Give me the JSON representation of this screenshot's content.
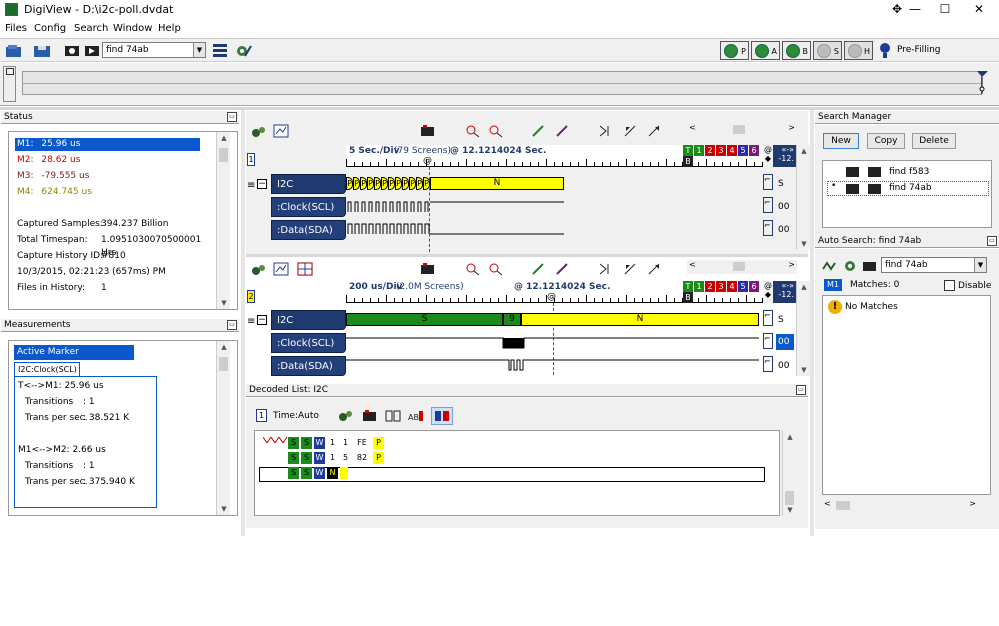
{
  "window": {
    "title": "DigiView - D:\\i2c-poll.dvdat",
    "pin": "✥",
    "minimize": "—",
    "maximize": "☐",
    "close": "✕"
  },
  "menu": [
    "Files",
    "Config",
    "Search",
    "Window",
    "Help"
  ],
  "toolbar": {
    "search_value": "find 74ab",
    "run_buttons": [
      "P",
      "A",
      "B",
      "S",
      "H"
    ],
    "status": "Pre-Filling"
  },
  "status_panel": {
    "title": "Status",
    "markers": [
      {
        "label": "M1:",
        "value": "25.96 us",
        "color": "#ffffff"
      },
      {
        "label": "M2:",
        "value": "28.62 us",
        "color": "#cc0000"
      },
      {
        "label": "M3:",
        "value": "-79.555 us",
        "color": "#7a1a1a"
      },
      {
        "label": "M4:",
        "value": "624.745 us",
        "color": "#8a8a00"
      }
    ],
    "stats": [
      {
        "label": "Captured Samples:",
        "value": "394.237 Billion"
      },
      {
        "label": "Total Timespan:",
        "value": "1.0951030070500001 Hrs"
      },
      {
        "label": "Capture History ID:",
        "value": "#810"
      },
      {
        "label": "10/3/2015, 02:21:23 (657ms) PM",
        "value": ""
      },
      {
        "label": "Files in History:",
        "value": "1"
      }
    ]
  },
  "measurements_panel": {
    "title": "Measurements",
    "tab": "Active Marker Measurements",
    "subtab": "I2C:Clock(SCL)",
    "groups": [
      {
        "title": "T<-->M1:",
        "value": "25.96 us",
        "transitions_label": "Transitions",
        "transitions": ": 1",
        "trans_label": "Trans per sec.",
        "trans": ": 38.521 K"
      },
      {
        "title": "M1<-->M2:",
        "value": "2.66 us",
        "transitions_label": "Transitions",
        "transitions": ": 1",
        "trans_label": "Trans per sec.",
        "trans": ": 375.940 K"
      }
    ]
  },
  "waveform1": {
    "index": "1",
    "scale": "5 Sec./Div",
    "screens": "(79 Screens)",
    "position": "@ 12.1214024 Sec.",
    "bus": "I2C",
    "signals": [
      ":Clock(SCL)",
      ":Data(SDA)"
    ],
    "bus_value": "N",
    "start_marks": [
      "P",
      "P",
      "P",
      "P",
      "P",
      "P",
      "P",
      "P",
      "P",
      "P",
      "P",
      "P"
    ],
    "right_vals": [
      "S",
      "00",
      "00"
    ],
    "nav_left": "«-»",
    "nav_right": "-12."
  },
  "waveform2": {
    "index": "2",
    "scale": "200 us/Div",
    "screens": "(2.0M Screens)",
    "position": "@ 12.1214024 Sec.",
    "bus": "I2C",
    "signals": [
      ":Clock(SCL)",
      ":Data(SDA)"
    ],
    "bus_segments": [
      "S",
      "9",
      "N"
    ],
    "right_vals": [
      "S",
      "00",
      "00"
    ],
    "nav_left": "«-»",
    "nav_right": "-12."
  },
  "marker_boxes": [
    {
      "label": "T",
      "color": "#1a8a1a"
    },
    {
      "label": "1",
      "color": "#1a8a1a"
    },
    {
      "label": "2",
      "color": "#cc0000"
    },
    {
      "label": "3",
      "color": "#cc0000"
    },
    {
      "label": "4",
      "color": "#cc0000"
    },
    {
      "label": "5",
      "color": "#2a2aaa"
    },
    {
      "label": "6",
      "color": "#7a1a7a"
    },
    {
      "label": "B",
      "color": "#222222"
    }
  ],
  "decoded_list": {
    "title": "Decoded List: I2C",
    "index": "1",
    "time_label": "Time:",
    "time_value": "Auto",
    "rows": [
      {
        "cells": [
          "S",
          "S",
          "W",
          "1",
          "1",
          "FE",
          "P"
        ]
      },
      {
        "cells": [
          "S",
          "S",
          "W",
          "1",
          "5",
          "82",
          "P"
        ]
      },
      {
        "cells": [
          "S",
          "S",
          "W",
          "N"
        ]
      }
    ]
  },
  "search_manager": {
    "title": "Search Manager",
    "buttons": [
      "New",
      "Copy",
      "Delete"
    ],
    "items": [
      "find f583",
      "find 74ab"
    ]
  },
  "auto_search": {
    "title": "Auto Search: find 74ab",
    "select_value": "find 74ab",
    "marker": "M1",
    "matches": "Matches: 0",
    "disable": "Disable",
    "no_matches": "No Matches"
  }
}
